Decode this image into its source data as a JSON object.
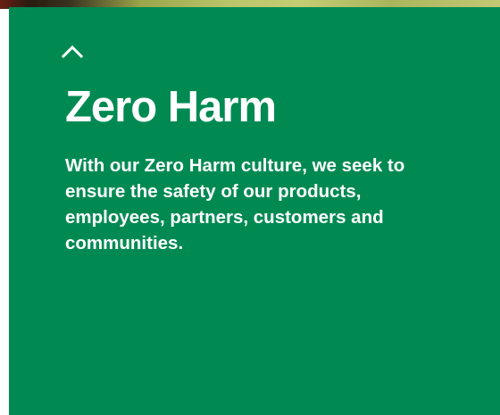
{
  "panel": {
    "toggle_icon": "chevron-up-icon",
    "title": "Zero Harm",
    "description": "With our Zero Harm culture, we seek to ensure the safety of our products, employees, partners, customers and communities.",
    "background_color": "#008a52",
    "text_color": "#ffffff"
  }
}
